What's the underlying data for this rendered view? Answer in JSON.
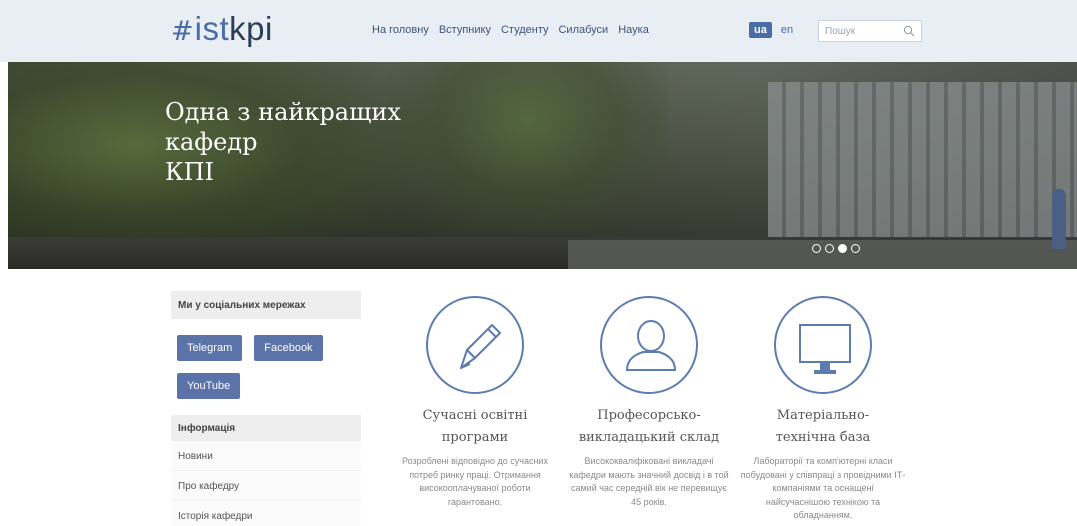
{
  "logo": {
    "hash": "#",
    "ist": "ist",
    "kpi": "kpi"
  },
  "nav": {
    "items": [
      "На головну",
      "Вступнику",
      "Студенту",
      "Силабуси",
      "Наука"
    ]
  },
  "lang": {
    "ua": "ua",
    "en": "en"
  },
  "search": {
    "placeholder": "Пошук",
    "icon": "search-icon"
  },
  "hero": {
    "title_line1": "Одна з найкращих",
    "title_line2": "кафедр",
    "title_line3": "КПІ",
    "dots_total": 4,
    "active_dot_index": 2
  },
  "sidebar": {
    "social_heading": "Ми у соціальних мережах",
    "social_buttons": [
      "Telegram",
      "Facebook",
      "YouTube"
    ],
    "info_heading": "Інформація",
    "info_items": [
      "Новини",
      "Про кафедру",
      "Історія кафедри"
    ]
  },
  "features": [
    {
      "icon": "pencil-icon",
      "title_line1": "Сучасні освітні",
      "title_line2": "програми",
      "desc": "Розроблені відповідно до сучасних потреб ринку праці. Отримання високооплачуваної роботи гарантовано."
    },
    {
      "icon": "user-icon",
      "title_line1": "Професорсько-",
      "title_line2": "викладацький склад",
      "desc": "Висококваліфіковані викладачі кафедри мають значний досвід і в той самий час середній вік не перевищує 45 років."
    },
    {
      "icon": "monitor-icon",
      "title_line1": "Матеріально-",
      "title_line2": "технічна база",
      "desc": "Лабораторії та комп'ютерні класи побудовані у співпраці з провідними ІТ-компаніями та оснащені найсучаснішою технікою та обладнанням."
    }
  ],
  "colors": {
    "accent": "#4a6da7",
    "header_bg": "#e9eef5",
    "button": "#5b73a8"
  }
}
